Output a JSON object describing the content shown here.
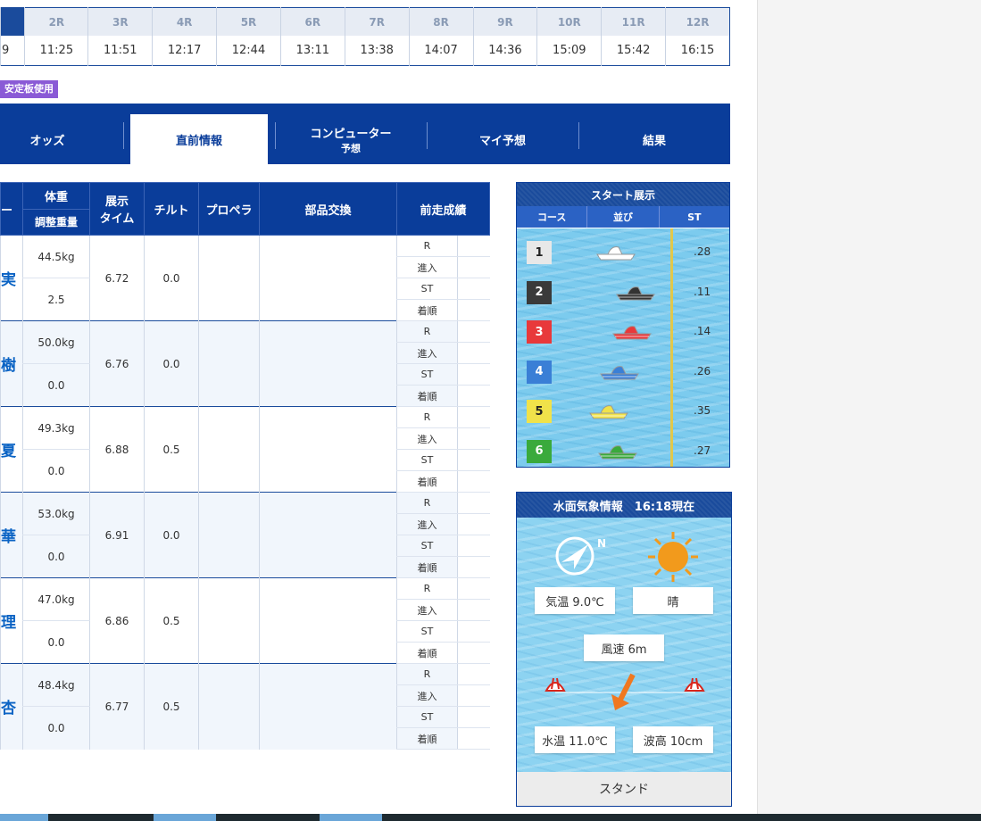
{
  "schedule": {
    "races": [
      "",
      "2R",
      "3R",
      "4R",
      "5R",
      "6R",
      "7R",
      "8R",
      "9R",
      "10R",
      "11R",
      "12R"
    ],
    "times": [
      "9",
      "11:25",
      "11:51",
      "12:17",
      "12:44",
      "13:11",
      "13:38",
      "14:07",
      "14:36",
      "15:09",
      "15:42",
      "16:15"
    ]
  },
  "badge": "安定板使用",
  "tabs": {
    "odds": "オッズ",
    "pre_info": "直前情報",
    "computer": "コンピューター",
    "computer_sub": "予想",
    "my_pred": "マイ予想",
    "result": "結果"
  },
  "table": {
    "col_first": "ー",
    "weight": "体重",
    "adjust": "調整重量",
    "exhibit_1": "展示",
    "exhibit_2": "タイム",
    "tilt": "チルト",
    "propeller": "プロペラ",
    "parts": "部品交換",
    "prev": "前走成績",
    "r_labels": [
      "R",
      "進入",
      "ST",
      "着順"
    ],
    "rows": [
      {
        "name": "実",
        "weight": "44.5kg",
        "adjust": "2.5",
        "time": "6.72",
        "tilt": "0.0"
      },
      {
        "name": "樹",
        "weight": "50.0kg",
        "adjust": "0.0",
        "time": "6.76",
        "tilt": "0.0"
      },
      {
        "name": "夏",
        "weight": "49.3kg",
        "adjust": "0.0",
        "time": "6.88",
        "tilt": "0.5"
      },
      {
        "name": "華",
        "weight": "53.0kg",
        "adjust": "0.0",
        "time": "6.91",
        "tilt": "0.0"
      },
      {
        "name": "理",
        "weight": "47.0kg",
        "adjust": "0.0",
        "time": "6.86",
        "tilt": "0.5"
      },
      {
        "name": "杏",
        "weight": "48.4kg",
        "adjust": "0.0",
        "time": "6.77",
        "tilt": "0.5"
      }
    ]
  },
  "start": {
    "title": "スタート展示",
    "col_course": "コース",
    "col_order": "並び",
    "col_st": "ST",
    "lanes": [
      {
        "course": "1",
        "st": ".28",
        "color": "#e8e8e8",
        "text": "#222",
        "boat": "#ffffff"
      },
      {
        "course": "2",
        "st": ".11",
        "color": "#3a3a3a",
        "text": "#fff",
        "boat": "#333333"
      },
      {
        "course": "3",
        "st": ".14",
        "color": "#e8393b",
        "text": "#fff",
        "boat": "#e8393b"
      },
      {
        "course": "4",
        "st": ".26",
        "color": "#3a7fd6",
        "text": "#fff",
        "boat": "#3a7fd6"
      },
      {
        "course": "5",
        "st": ".35",
        "color": "#f0e24a",
        "text": "#222",
        "boat": "#f0e24a"
      },
      {
        "course": "6",
        "st": ".27",
        "color": "#3aaa3c",
        "text": "#fff",
        "boat": "#3aaa3c"
      }
    ]
  },
  "weather": {
    "title": "水面気象情報　16:18現在",
    "temp": "気温 9.0℃",
    "condition": "晴",
    "wind": "風速 6m",
    "water_temp": "水温 11.0℃",
    "wave": "波高 10cm",
    "compass_n": "N",
    "stand": "スタンド"
  }
}
